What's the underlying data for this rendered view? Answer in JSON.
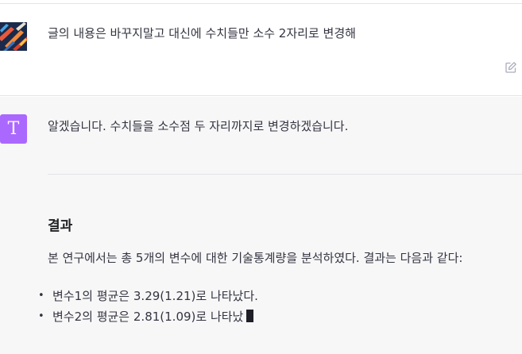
{
  "conversation": {
    "user_message": "글의 내용은 바꾸지말고 대신에 수치들만 소수 2자리로 변경해",
    "assistant": {
      "avatar_letter": "T",
      "intro": "알겠습니다. 수치들을 소수점 두 자리까지로 변경하겠습니다.",
      "heading": "결과",
      "paragraph": "본 연구에서는 총 5개의 변수에 대한 기술통계량을 분석하였다. 결과는 다음과 같다:",
      "bullets": [
        "변수1의 평균은 3.29(1.21)로 나타났다.",
        "변수2의 평균은 2.81(1.09)로 나타났"
      ]
    }
  },
  "icons": {
    "user_avatar": "abstract-art-avatar",
    "edit": "edit-pencil-icon",
    "assistant_avatar": "letter-avatar"
  },
  "colors": {
    "assistant_avatar_bg": "#ab68ff",
    "assistant_row_bg": "#f7f7f8"
  }
}
